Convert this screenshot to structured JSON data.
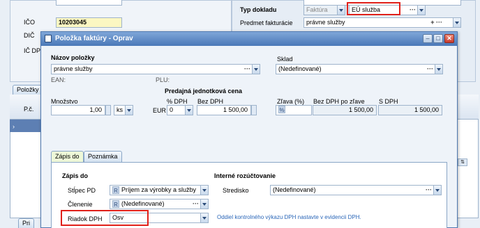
{
  "background_form": {
    "ico_label": "IČO",
    "ico_value": "10203045",
    "dic_label": "DIČ",
    "icdph_label": "IČ DPH",
    "typ_dokladu_label": "Typ dokladu",
    "typ_dokladu_value_1": "Faktúra",
    "typ_dokladu_value_2": "EÚ služba",
    "predmet_label": "Predmet fakturácie",
    "predmet_value": "právne služby",
    "tab_polozky": "Položky",
    "col_pc": "P.č.",
    "bottom_tab": "Pri"
  },
  "dialog": {
    "title": "Položka faktúry - Oprav",
    "nazov_label": "Názov položky",
    "nazov_value": "právne služby",
    "sklad_label": "Sklad",
    "sklad_value": "(Nedefinované)",
    "ean_label": "EAN:",
    "plu_label": "PLU:",
    "cena_header": "Predajná jednotková cena",
    "mnozstvo_label": "Množstvo",
    "mnozstvo_value": "1,00",
    "unit_value": "ks",
    "dph_label": "% DPH",
    "currency": "EUR",
    "dph_value": "0",
    "bez_dph_label": "Bez DPH",
    "bez_dph_value": "1 500,00",
    "zlava_label": "Zľava (%)",
    "zlava_value": "%",
    "bez_dph_po_zlave_label": "Bez DPH po zľave",
    "bez_dph_po_zlave_value": "1 500,00",
    "s_dph_label": "S DPH",
    "s_dph_value": "1 500,00",
    "tab_zapis": "Zápis do",
    "tab_poznamka": "Poznámka",
    "zapis_header": "Zápis do",
    "stlpec_label": "Stĺpec PD",
    "stlpec_tag": "R",
    "stlpec_value": "Príjem za výrobky a služby",
    "clenenie_label": "Členenie",
    "clenenie_tag": "R",
    "clenenie_value": "(Nedefinované)",
    "riadok_label": "Riadok DPH",
    "riadok_value": "Osv",
    "interne_header": "Interné rozúčtovanie",
    "stredisko_label": "Stredisko",
    "stredisko_value": "(Nedefinované)",
    "hint": "Oddiel kontrolného výkazu DPH nastavte v evidencii DPH."
  },
  "icons": [
    "minimize-icon",
    "maximize-icon",
    "close-icon",
    "dropdown-icon",
    "ellipsis-icon",
    "spinner-icon"
  ]
}
